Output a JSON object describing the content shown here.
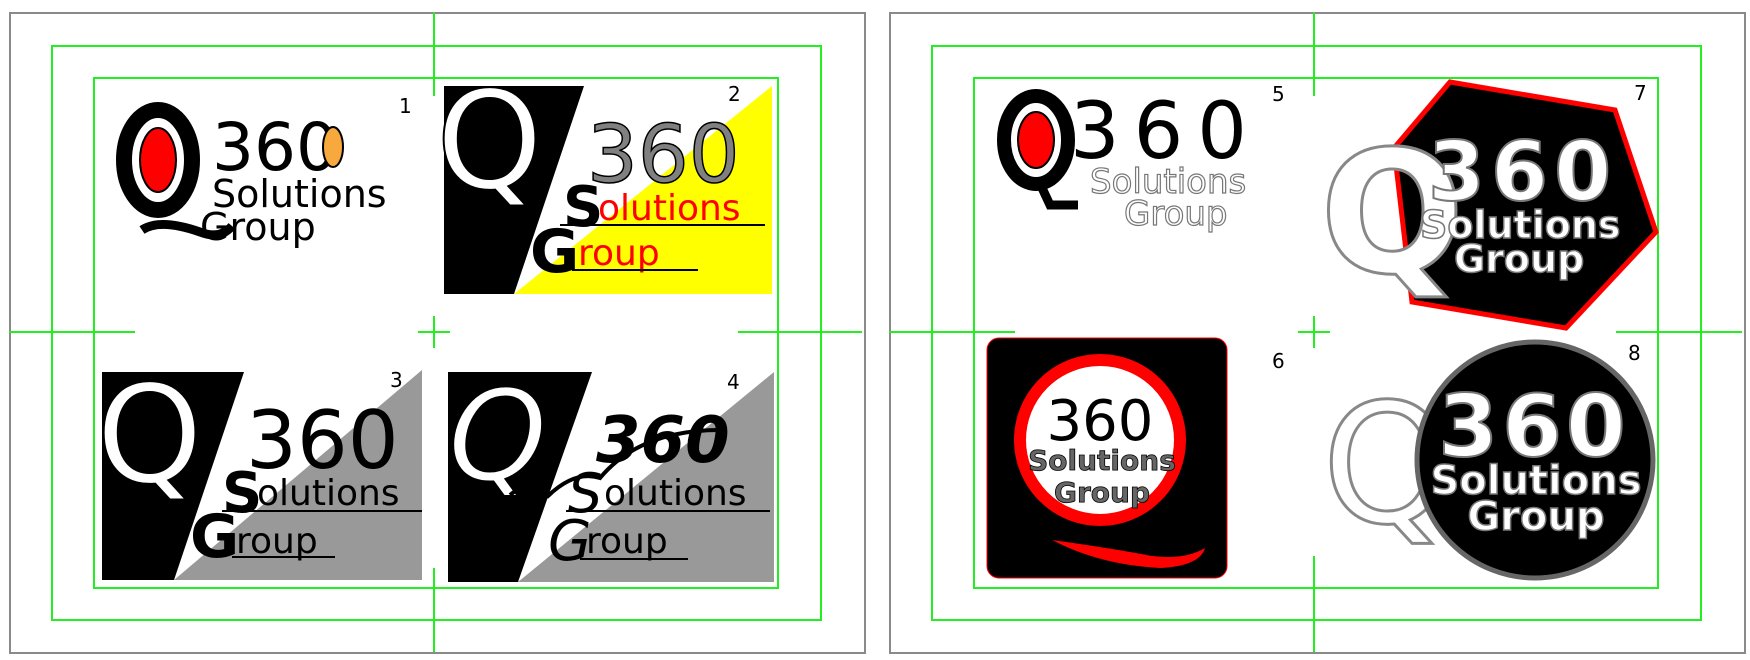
{
  "colors": {
    "guide": "#22ee22",
    "page_border": "#8a8a8a",
    "black": "#000000",
    "red": "#ff0000",
    "orange": "#f7a93d",
    "yellow": "#ffff00",
    "gray": "#999999",
    "dark_gray": "#666666"
  },
  "logos": [
    {
      "number": "1",
      "q": "Q",
      "num": "360",
      "line1": "Solutions",
      "line2": "Group"
    },
    {
      "number": "2",
      "q": "Q",
      "num": "360",
      "s": "S",
      "line1": "olutions",
      "g": "G",
      "line2": "roup"
    },
    {
      "number": "3",
      "q": "Q",
      "num": "360",
      "s": "S",
      "line1": "olutions",
      "g": "G",
      "line2": "roup"
    },
    {
      "number": "4",
      "q": "Q",
      "num": "360",
      "s": "S",
      "line1": "olutions",
      "g": "G",
      "line2": "roup"
    },
    {
      "number": "5",
      "q": "Q",
      "num": "360",
      "line1": "Solutions",
      "line2": "Group"
    },
    {
      "number": "6",
      "num": "360",
      "line1": "Solutions",
      "line2": "Group"
    },
    {
      "number": "7",
      "q": "Q",
      "num": "360",
      "line1": "Solutions",
      "line2": "Group"
    },
    {
      "number": "8",
      "q": "Q",
      "num": "360",
      "line1": "Solutions",
      "line2": "Group"
    }
  ]
}
